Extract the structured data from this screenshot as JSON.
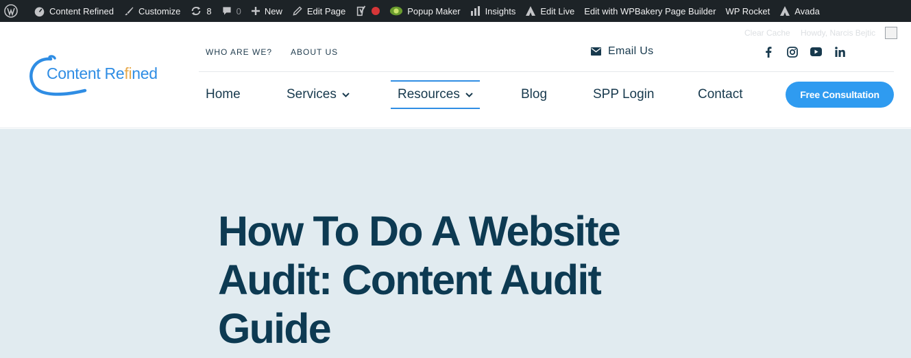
{
  "adminbar": {
    "site_name": "Content Refined",
    "customize": "Customize",
    "updates_count": "8",
    "comments_count": "0",
    "new": "New",
    "edit_page": "Edit Page",
    "popup_maker": "Popup Maker",
    "insights": "Insights",
    "edit_live": "Edit Live",
    "wpbakery": "Edit with WPBakery Page Builder",
    "wp_rocket": "WP Rocket",
    "avada": "Avada",
    "seo_status_color": "#d63638"
  },
  "header": {
    "clear_cache": "Clear Cache",
    "howdy": "Howdy, Narcis Bejtic",
    "logo": {
      "part1": "Content Re",
      "accent": "fi",
      "part2": "ned"
    },
    "top_links": [
      "WHO ARE WE?",
      "ABOUT US"
    ],
    "email_label": "Email Us",
    "social_icons": [
      "facebook-icon",
      "instagram-icon",
      "youtube-icon",
      "linkedin-icon"
    ],
    "nav": {
      "home": "Home",
      "services": "Services",
      "resources": "Resources",
      "blog": "Blog",
      "spp_login": "SPP Login",
      "contact": "Contact"
    },
    "cta_label": "Free Consultation",
    "brand_color": "#2f8de4",
    "accent_color": "#e8a94a"
  },
  "hero": {
    "title": "How To Do A Website Audit: Content Audit Guide",
    "background": "#e1ebf0",
    "title_color": "#0d3a52"
  }
}
